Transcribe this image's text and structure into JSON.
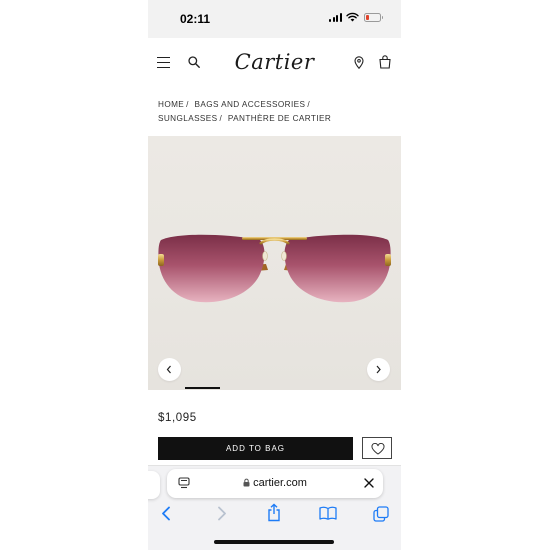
{
  "status_bar": {
    "time": "02:11",
    "battery_color": "#e0442d"
  },
  "header": {
    "brand": "Cartier",
    "icons": [
      "menu-icon",
      "search-icon",
      "location-pin-icon",
      "shopping-bag-icon"
    ]
  },
  "breadcrumb": {
    "items": [
      "HOME",
      "BAGS AND ACCESSORIES",
      "SUNGLASSES",
      "PANTHÈRE DE CARTIER"
    ],
    "separator": "/"
  },
  "product": {
    "price": "$1,095",
    "add_to_bag_label": "ADD TO BAG",
    "image_subject": "rimless sunglasses with pink-purple gradient lenses and gold panther temples",
    "carousel": {
      "prev_icon": "chevron-left-icon",
      "next_icon": "chevron-right-icon",
      "active_index": 0
    }
  },
  "browser": {
    "domain": "cartier.com",
    "icons": [
      "tabs-summary-icon",
      "lock-icon",
      "close-icon",
      "back-icon",
      "forward-icon",
      "share-icon",
      "bookmarks-icon",
      "tabs-icon"
    ],
    "accent": "#1e7cf6"
  }
}
